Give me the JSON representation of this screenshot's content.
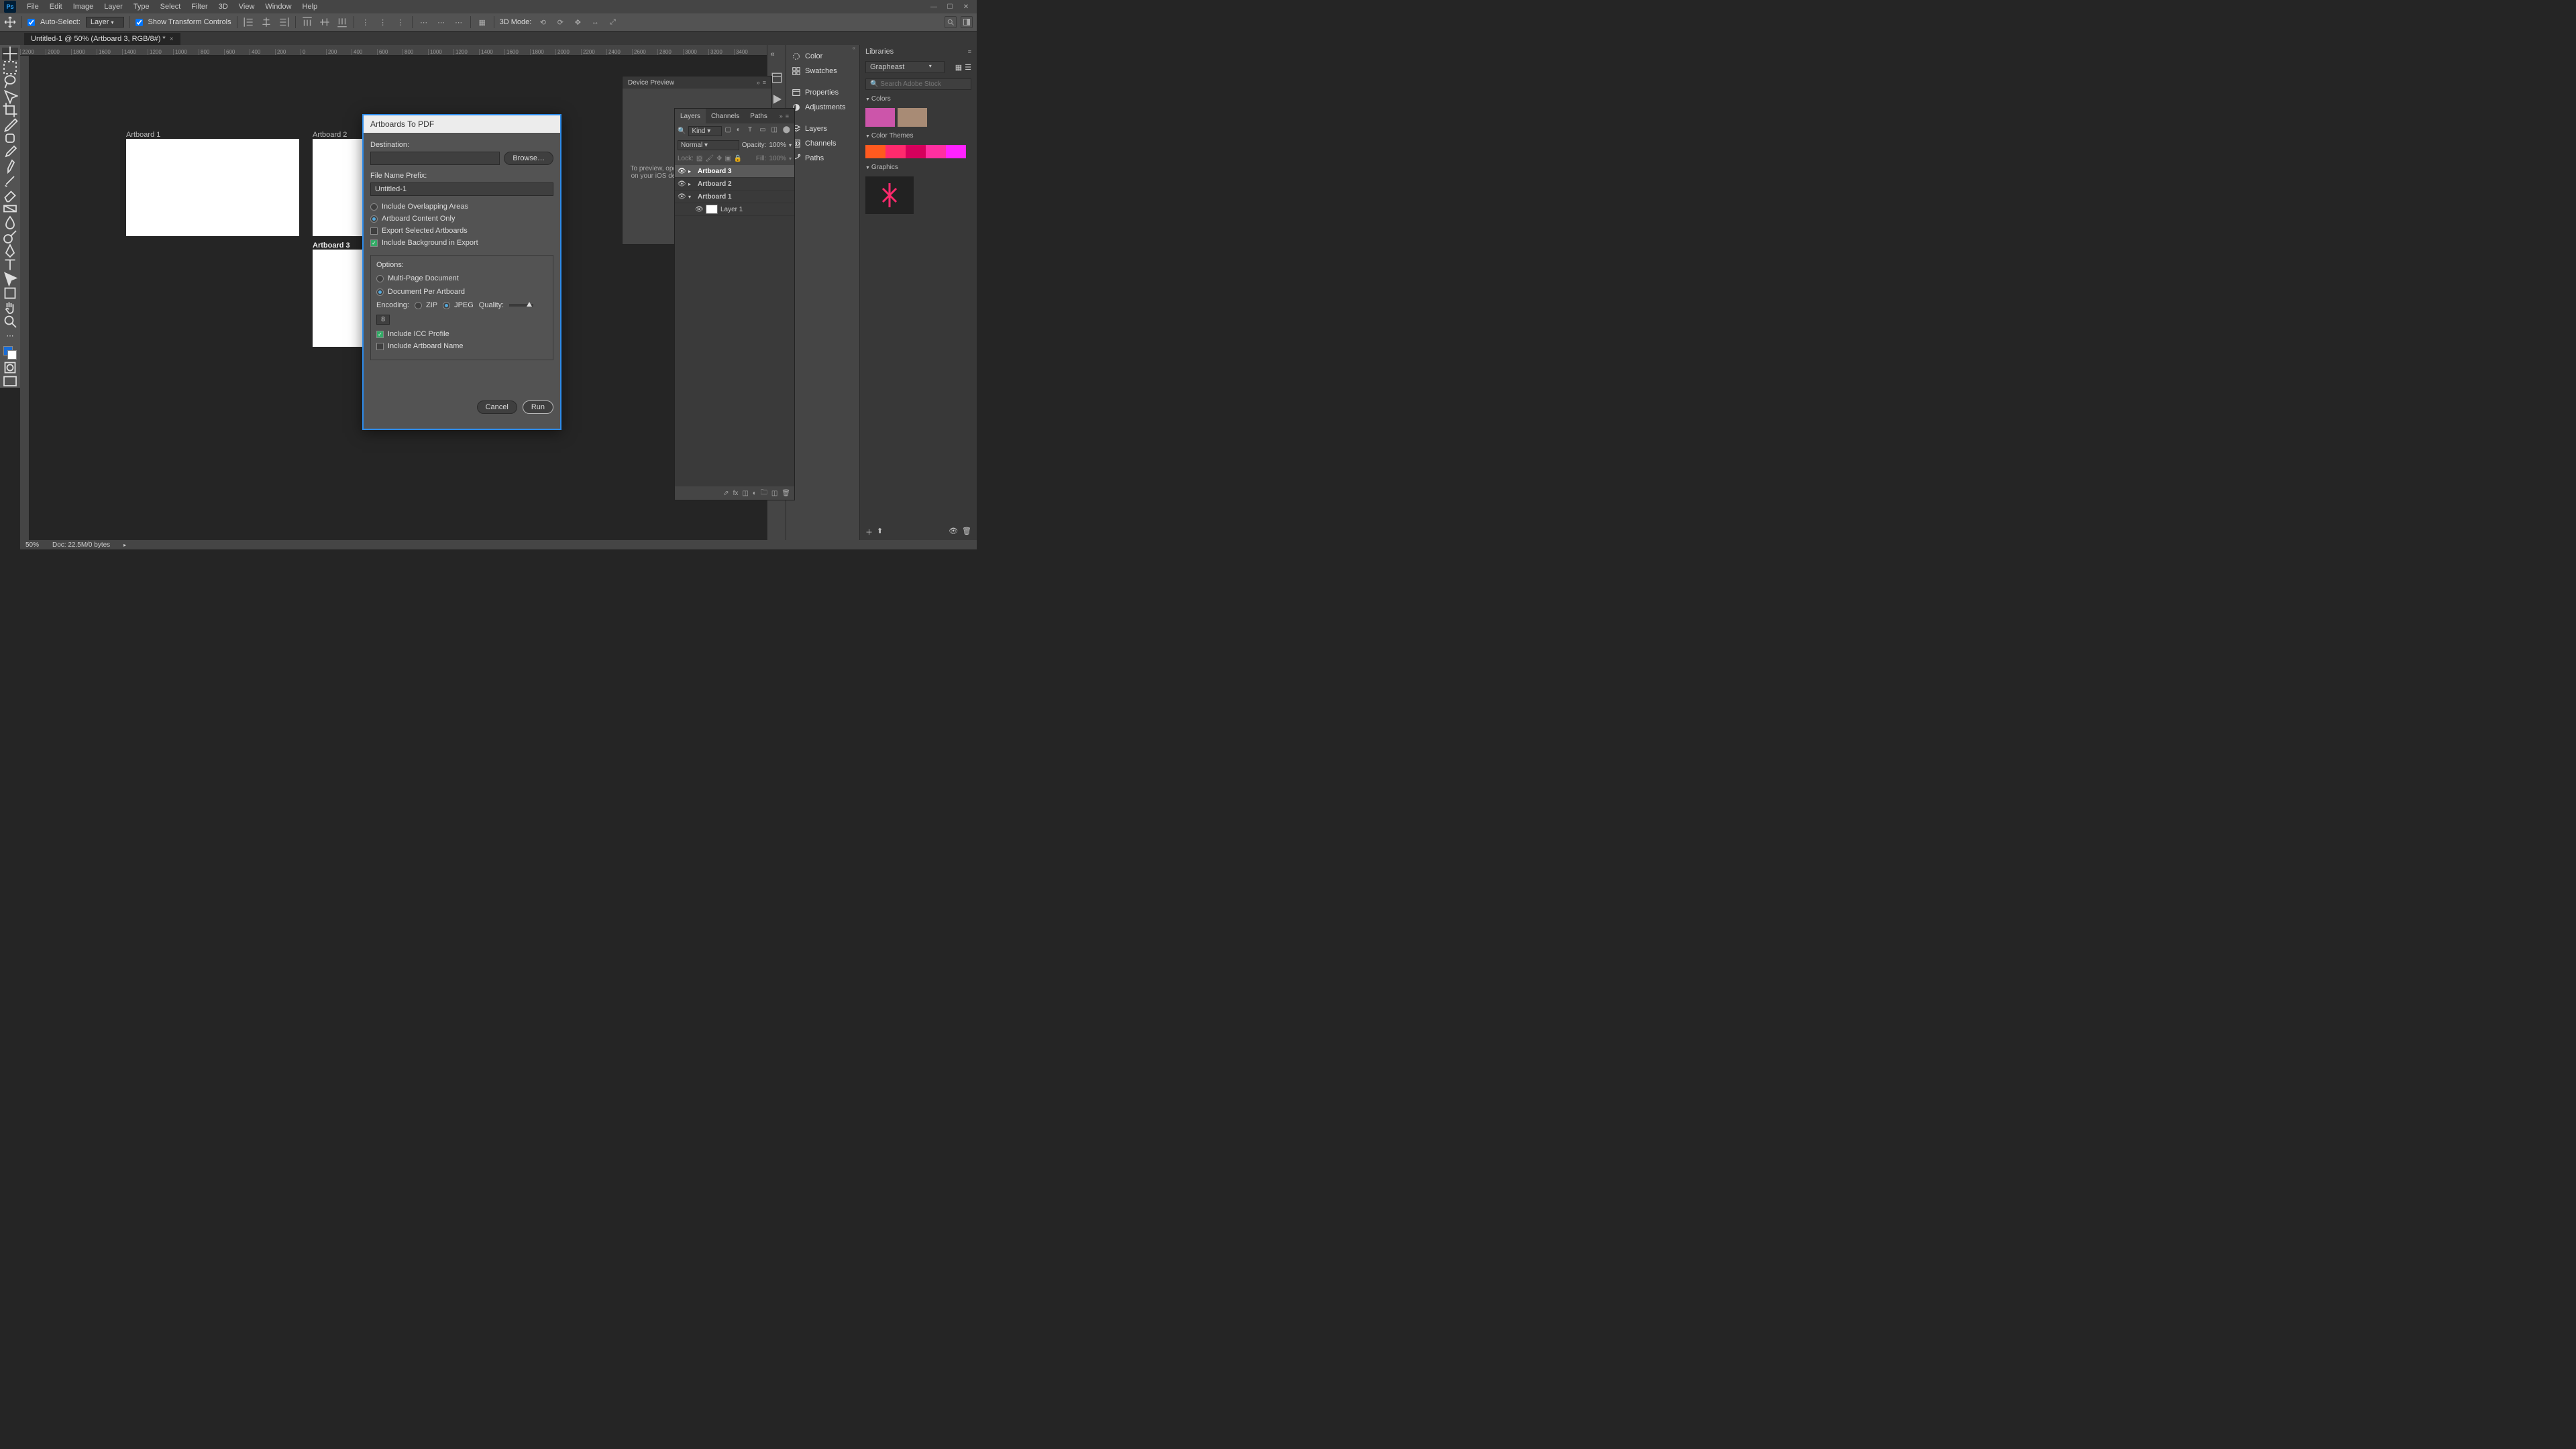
{
  "menu": [
    "File",
    "Edit",
    "Image",
    "Layer",
    "Type",
    "Select",
    "Filter",
    "3D",
    "View",
    "Window",
    "Help"
  ],
  "options": {
    "auto_select": "Auto-Select:",
    "layer": "Layer",
    "show_transform": "Show Transform Controls",
    "mode3d": "3D Mode:"
  },
  "doc_tab": "Untitled-1 @ 50% (Artboard 3, RGB/8#) *",
  "ruler_ticks": [
    "2200",
    "2000",
    "1800",
    "1600",
    "1400",
    "1200",
    "1000",
    "800",
    "600",
    "400",
    "200",
    "0",
    "200",
    "400",
    "600",
    "800",
    "1000",
    "1200",
    "1400",
    "1600",
    "1800",
    "2000",
    "2200",
    "2400",
    "2600",
    "2800",
    "3000",
    "3200",
    "3400"
  ],
  "artboards": {
    "a1": "Artboard 1",
    "a2": "Artboard 2",
    "a3": "Artboard 3"
  },
  "status": {
    "zoom": "50%",
    "doc": "Doc: 22.5M/0 bytes"
  },
  "panels_mid": [
    "Color",
    "Swatches",
    "Properties",
    "Adjustments",
    "Layers",
    "Channels",
    "Paths"
  ],
  "libraries": {
    "title": "Libraries",
    "selected": "Grapheast",
    "search_ph": "Search Adobe Stock",
    "sections": {
      "colors": "Colors",
      "themes": "Color Themes",
      "graphics": "Graphics"
    },
    "colors": [
      "#cc55aa",
      "#a88b75"
    ],
    "themes": [
      "#ff5a1f",
      "#ff2a6d",
      "#d6005c",
      "#ff2fa0",
      "#ff22ff"
    ]
  },
  "device_preview": {
    "title": "Device Preview",
    "text": "To preview, open the Preview CC mobile app on your iOS devices, launch the Preview CC mobile app..."
  },
  "layers_panel": {
    "tabs": [
      "Layers",
      "Channels",
      "Paths"
    ],
    "kind": "Kind",
    "blend": "Normal",
    "opacity_lbl": "Opacity:",
    "opacity": "100%",
    "lock": "Lock:",
    "fill_lbl": "Fill:",
    "fill": "100%",
    "items": [
      {
        "name": "Artboard 3",
        "sel": true,
        "artboard": true
      },
      {
        "name": "Artboard 2",
        "sel": false,
        "artboard": true
      },
      {
        "name": "Artboard 1",
        "sel": false,
        "artboard": true
      },
      {
        "name": "Layer 1",
        "sel": false,
        "artboard": false
      }
    ]
  },
  "dialog": {
    "title": "Artboards To PDF",
    "destination": "Destination:",
    "browse": "Browse…",
    "prefix_lbl": "File Name Prefix:",
    "prefix": "Untitled-1",
    "overlap": "Include Overlapping Areas",
    "content_only": "Artboard Content Only",
    "export_sel": "Export Selected Artboards",
    "include_bg": "Include Background in Export",
    "options": "Options:",
    "multipage": "Multi-Page Document",
    "perartboard": "Document Per Artboard",
    "encoding": "Encoding:",
    "zip": "ZIP",
    "jpeg": "JPEG",
    "quality": "Quality:",
    "quality_val": "8",
    "icc": "Include ICC Profile",
    "incname": "Include Artboard Name",
    "cancel": "Cancel",
    "run": "Run"
  }
}
